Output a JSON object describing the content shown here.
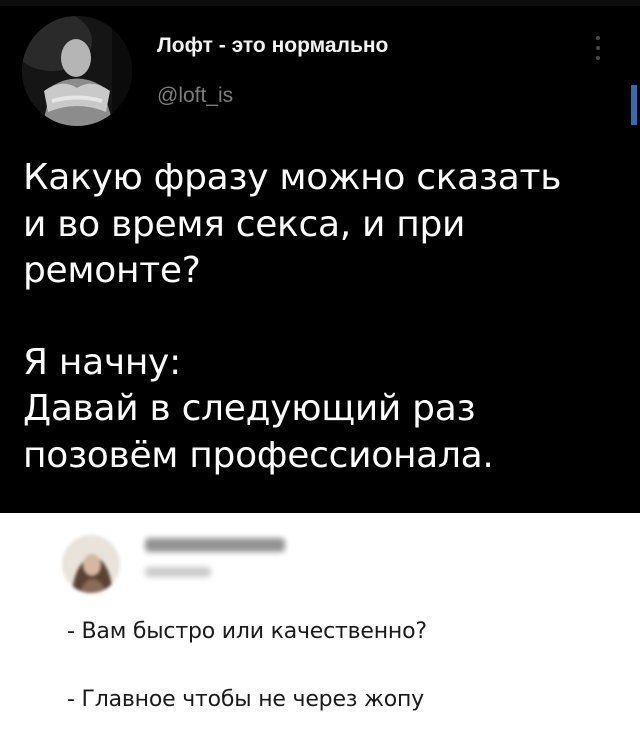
{
  "tweet": {
    "author_name": "Лофт - это нормально",
    "author_handle": "@loft_is",
    "avatar_icon": "profile-photo",
    "menu_icon": "vertical-ellipsis-icon",
    "text_lines": [
      "Какую фразу можно сказать",
      "и во время секса, и при",
      "ремонте?",
      "",
      "Я начну:",
      "Давай в следующий раз",
      "позовём профессионала."
    ]
  },
  "reply": {
    "avatar_icon": "blurred-profile-photo",
    "lines": [
      "- Вам быстро или качественно?",
      "- Главное чтобы не через жопу"
    ]
  },
  "colors": {
    "tweet_background": "#000000",
    "tweet_text": "#ffffff",
    "handle_text": "#7d7d7d",
    "reply_background": "#ffffff",
    "reply_text": "#1a1a1a"
  }
}
